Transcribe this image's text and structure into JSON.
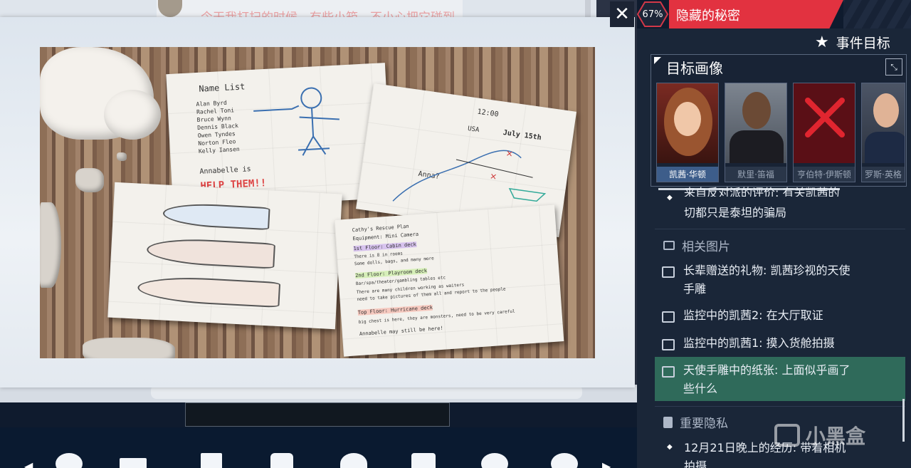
{
  "background_chat": {
    "message_text": "今天我打扫的时候，有些小箱，不小心把它碰到"
  },
  "photo": {
    "name_list_title": "Name List",
    "names": [
      "Alan Byrd",
      "Rachel Toni",
      "Bruce Wynn",
      "Dennis Black",
      "Owen Tyndes",
      "Norton Fleo",
      "Kelly Iansen"
    ],
    "annabelle_line": "Annabelle is",
    "help_line": "HELP THEM!!",
    "map_time": "12:00",
    "map_date": "July 15th",
    "map_place": "USA",
    "map_question": "Anna?",
    "plan_lines": [
      "Cathy's Rescue Plan",
      "Equipment: Mini Camera",
      "1st Floor: Cabin deck",
      "There is 8 in rooms",
      "Some dolls, bags, and many more",
      "2nd Floor: Playroom deck",
      "Bar/spa/theater/gambling tables etc",
      "There are many children working as waiters",
      "need to take pictures of them all and report to the people",
      "Top Floor: Hurricane deck",
      "big chest is here, they are monsters, need to be very careful",
      "Annabelle may still be here!"
    ]
  },
  "status": {
    "progress_percent": "67%",
    "progress_value": 0.67,
    "event_title": "隐藏的秘密"
  },
  "panel": {
    "event_goal_label": "事件目标",
    "portrait_section_title": "目标画像",
    "portraits": [
      {
        "name": "凯茜·华顿",
        "selected": true,
        "crossed": false
      },
      {
        "name": "默里·笛福",
        "selected": false,
        "crossed": false
      },
      {
        "name": "亨伯特·伊斯顿",
        "selected": false,
        "crossed": true
      },
      {
        "name": "罗斯·英格",
        "selected": false,
        "crossed": false
      }
    ],
    "partial_text_line1": "来自反对派的评价: 有关凯茜的",
    "partial_text_line2": "切都只是泰坦的骗局",
    "related_images_title": "相关图片",
    "related_images": [
      {
        "line1": "长辈赠送的礼物: 凯茜珍视的天使",
        "line2": "手雕",
        "selected": false
      },
      {
        "line1": "监控中的凯茜2: 在大厅取证",
        "line2": "",
        "selected": false
      },
      {
        "line1": "监控中的凯茜1: 摸入货舱拍摄",
        "line2": "",
        "selected": false
      },
      {
        "line1": "天使手雕中的纸张: 上面似乎画了",
        "line2": "些什么",
        "selected": true
      }
    ],
    "privacy_title": "重要隐私",
    "privacy_item_line1": "12月21日晚上的经历: 带着相机",
    "privacy_item_line2": "拍摄"
  },
  "watermark": {
    "text": "小黑盒"
  },
  "colors": {
    "accent_red": "#e23240",
    "selected_green": "#2f6a5a",
    "selected_portrait": "#3d5d8a"
  }
}
